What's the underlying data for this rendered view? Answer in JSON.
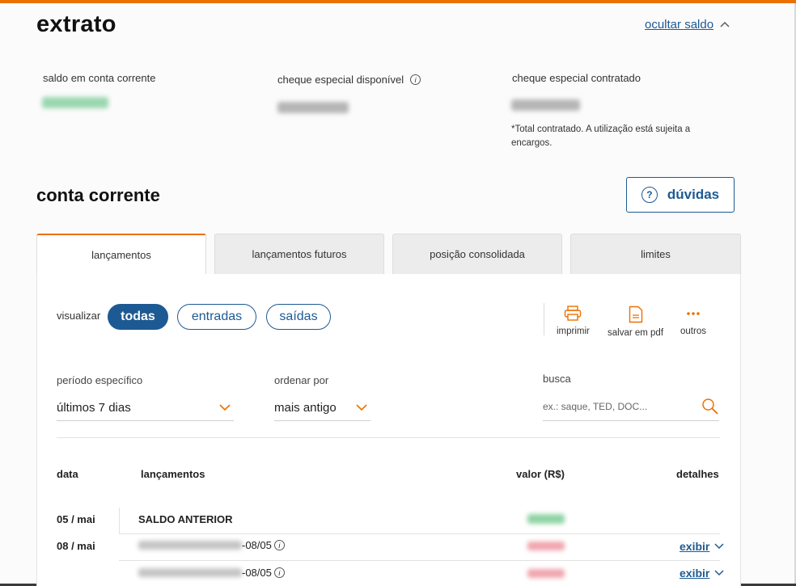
{
  "header": {
    "title": "extrato",
    "hide_balance_link": "ocultar saldo"
  },
  "balances": {
    "checking_label": "saldo em conta corrente",
    "overdraft_available_label": "cheque especial disponível",
    "overdraft_contracted_label": "cheque especial contratado",
    "note": "*Total contratado. A utilização está sujeita a encargos."
  },
  "section": {
    "title": "conta corrente",
    "help_button": "dúvidas"
  },
  "tabs": [
    {
      "label": "lançamentos",
      "active": true
    },
    {
      "label": "lançamentos futuros",
      "active": false
    },
    {
      "label": "posição consolidada",
      "active": false
    },
    {
      "label": "limites",
      "active": false
    }
  ],
  "filters": {
    "view_label": "visualizar",
    "view_options": [
      "todas",
      "entradas",
      "saídas"
    ],
    "view_selected": "todas",
    "period_label": "período específico",
    "period_value": "últimos 7 dias",
    "order_label": "ordenar por",
    "order_value": "mais antigo",
    "search_label": "busca",
    "search_placeholder": "ex.: saque, TED, DOC..."
  },
  "actions": {
    "print": "imprimir",
    "pdf": "salvar em pdf",
    "more": "outros"
  },
  "table": {
    "headers": [
      "data",
      "lançamentos",
      "valor (R$)",
      "detalhes"
    ],
    "rows": [
      {
        "date": "05 / mai",
        "description": "SALDO ANTERIOR",
        "details": ""
      },
      {
        "date": "08 / mai",
        "description_suffix": "-08/05",
        "details": "exibir"
      },
      {
        "date": "",
        "description_suffix": "-08/05",
        "details": "exibir"
      }
    ]
  },
  "colors": {
    "accent": "#ec7000",
    "primary": "#1d5a93",
    "positive_blur": "#8fd3a4",
    "negative_blur": "#f0a5ae"
  }
}
